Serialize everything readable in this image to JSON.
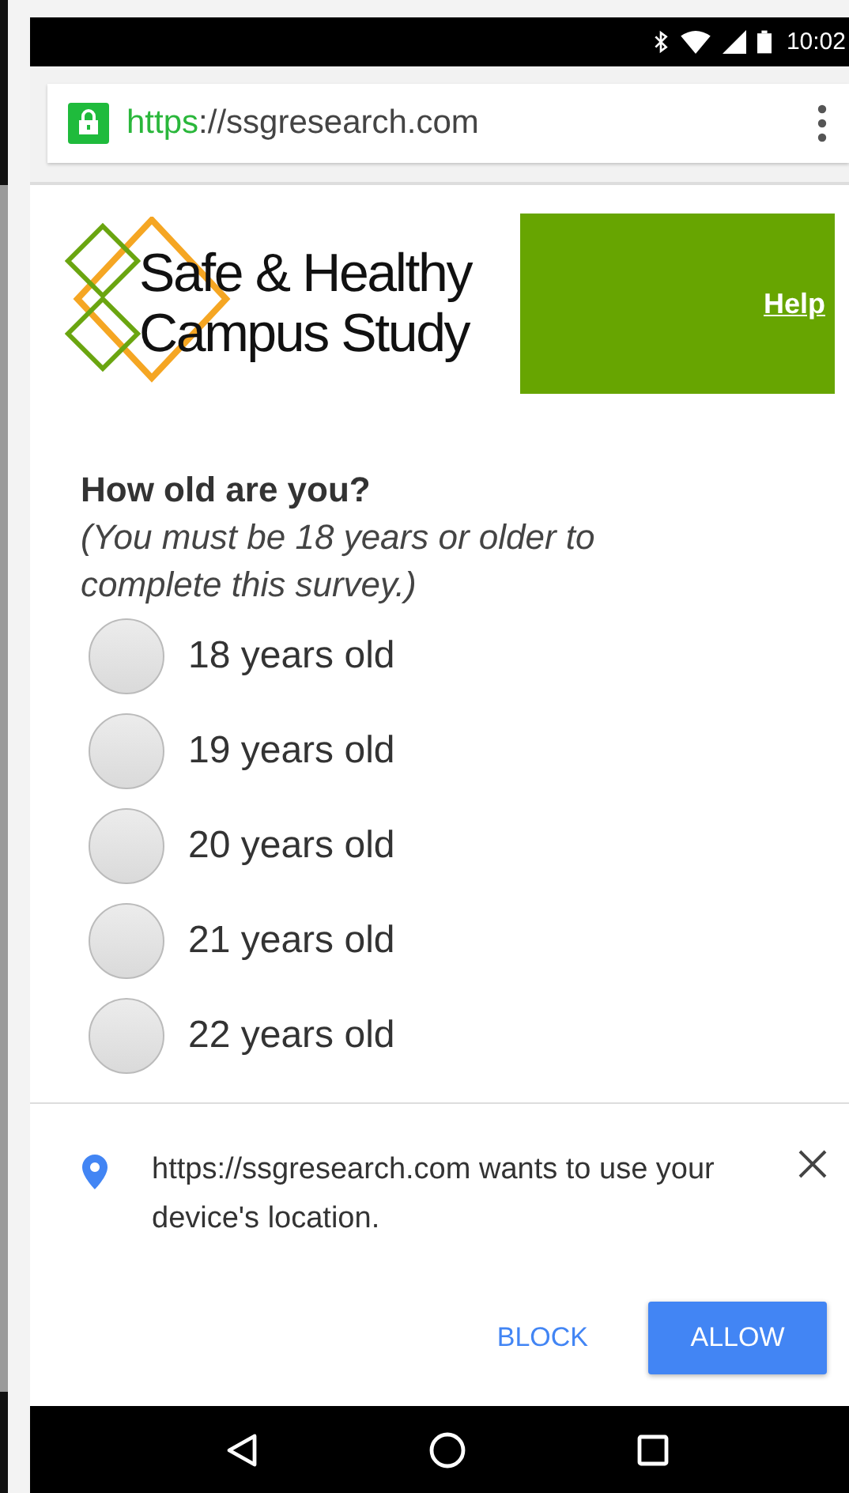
{
  "status_bar": {
    "time": "10:02"
  },
  "address_bar": {
    "scheme": "https",
    "rest": "://ssgresearch.com",
    "secure": true
  },
  "header": {
    "logo_lines": [
      "Safe & Healthy",
      "Campus Study"
    ],
    "help_link": "Help"
  },
  "question": {
    "title": "How old are you?",
    "note": "(You must be 18 years or older to complete this survey.)",
    "options": [
      {
        "label": "18 years old",
        "selected": false
      },
      {
        "label": "19 years old",
        "selected": false
      },
      {
        "label": "20 years old",
        "selected": false
      },
      {
        "label": "21 years old",
        "selected": false
      },
      {
        "label": "22 years old",
        "selected": false
      }
    ]
  },
  "permission_prompt": {
    "message": "https://ssgresearch.com wants to use your device's location.",
    "buttons": [
      {
        "label": "BLOCK",
        "kind": "text"
      },
      {
        "label": "ALLOW",
        "kind": "filled"
      }
    ]
  }
}
